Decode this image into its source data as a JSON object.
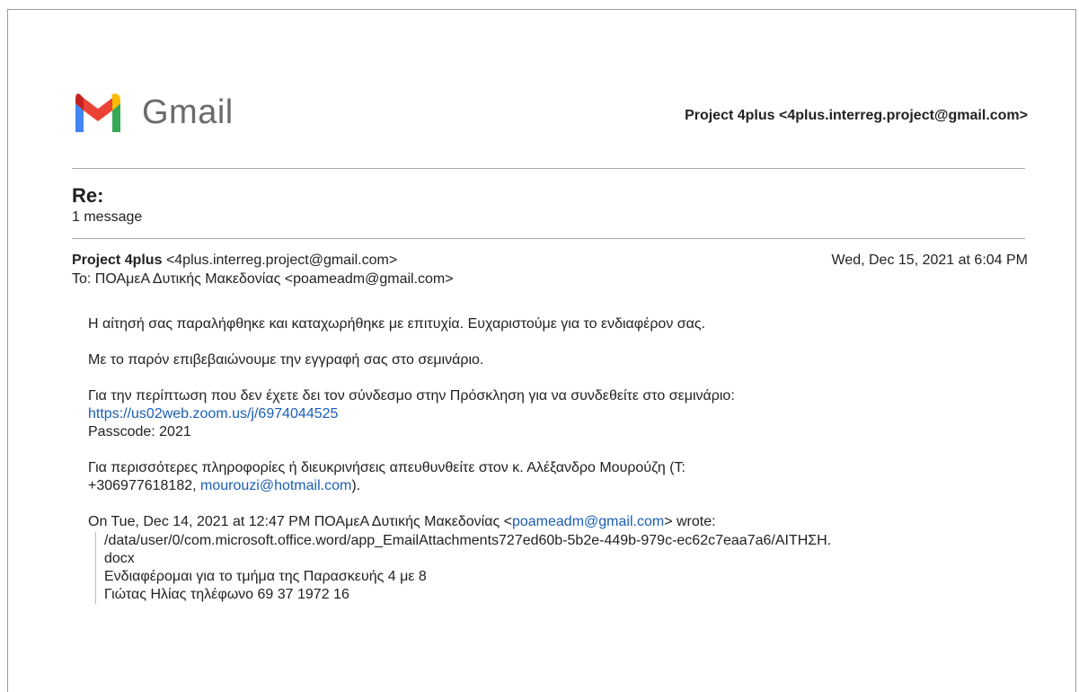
{
  "header": {
    "logo_text": "Gmail",
    "account": "Project 4plus <4plus.interreg.project@gmail.com>"
  },
  "thread": {
    "subject": "Re:",
    "message_count": "1 message"
  },
  "message": {
    "sender_name": "Project 4plus",
    "sender_email": "<4plus.interreg.project@gmail.com>",
    "date": "Wed, Dec 15, 2021 at 6:04 PM",
    "to": "To: ΠΟΑμεΑ Δυτικής Μακεδονίας <poameadm@gmail.com>",
    "body": {
      "para1": "Η αίτησή σας παραλήφθηκε και καταχωρήθηκε με επιτυχία. Ευχαριστούμε για το ενδιαφέρον σας.",
      "para2": "Με το παρόν επιβεβαιώνουμε την εγγραφή σας στο σεμινάριο.",
      "para3_line1": "Για την περίπτωση που δεν έχετε δει τον σύνδεσμο στην Πρόσκληση για να συνδεθείτε στο σεμινάριο:",
      "zoom_link": "https://us02web.zoom.us/j/6974044525",
      "passcode": "Passcode: 2021",
      "para4_line1": "Για περισσότερες πληροφορίες ή διευκρινήσεις απευθυνθείτε στον κ. Αλέξανδρο Μουρούζη (Τ:",
      "para4_phone": "+306977618182, ",
      "para4_email": "mourouzi@hotmail.com",
      "para4_end": ")."
    },
    "quote": {
      "intro_prefix": "On Tue, Dec 14, 2021 at 12:47 PM ΠΟΑμεΑ Δυτικής Μακεδονίας <",
      "intro_email": "poameadm@gmail.com",
      "intro_suffix": "> wrote:",
      "path_line1": "/data/user/0/com.microsoft.office.word/app_EmailAttachments727ed60b-5b2e-449b-979c-ec62c7eaa7a6/ΑΙΤΗΣΗ.",
      "path_line2": "docx",
      "line3": "Ενδιαφέρομαι για το τμήμα της Παρασκευής 4 με 8",
      "line4": "Γιώτας Ηλίας τηλέφωνο 69 37 1972 16"
    }
  },
  "colors": {
    "link": "#1a5fb4",
    "logo_text": "#6b6b6b",
    "rule": "#aaaaaa"
  }
}
